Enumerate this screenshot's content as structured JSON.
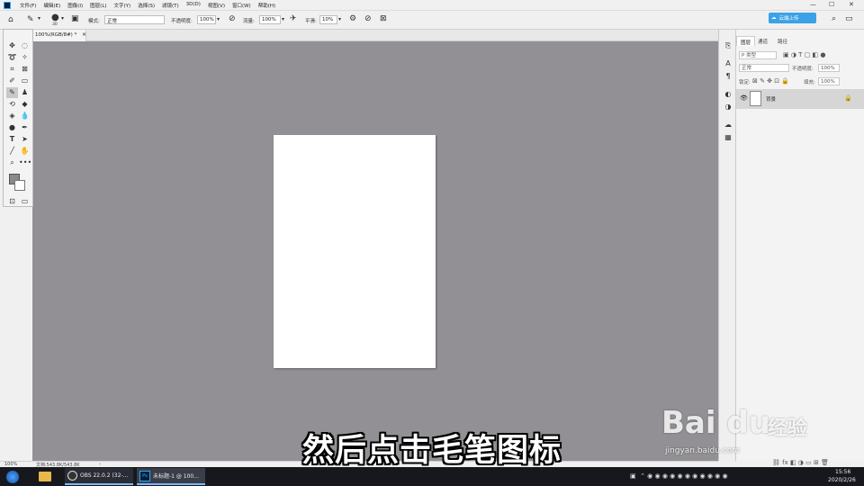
{
  "menubar": {
    "items": [
      "文件(F)",
      "编辑(E)",
      "图像(I)",
      "图层(L)",
      "文字(Y)",
      "选择(S)",
      "滤镜(T)",
      "3D(D)",
      "视图(V)",
      "窗口(W)",
      "帮助(H)"
    ],
    "minimize": "—",
    "maximize": "☐",
    "close": "✕"
  },
  "options": {
    "brush_size": "30",
    "mode_label": "模式:",
    "mode_value": "正常",
    "opacity_label": "不透明度:",
    "opacity_value": "100%",
    "flow_label": "流量:",
    "flow_value": "100%",
    "smoothing_label": "平滑:",
    "smoothing_value": "10%",
    "cloud_upload": "云端上传"
  },
  "document": {
    "tab_title": "100%(RGB/8#) *",
    "close_glyph": "✕"
  },
  "panel": {
    "tabs": [
      "图层",
      "通道",
      "路径"
    ],
    "kind_filter": "P 类型",
    "blend_mode": "正常",
    "opacity_label": "不透明度:",
    "opacity_value": "100%",
    "lock_label": "锁定:",
    "fill_label": "填充:",
    "fill_value": "100%",
    "layer_name": "背景"
  },
  "status": {
    "zoom": "100%",
    "doc_info": "文档:543.8K/543.8K",
    "arrow": "›"
  },
  "taskbar": {
    "obs_label": "OBS 22.0.2 (32-...",
    "ps_label": "未标题-1 @ 100...",
    "ps_badge": "Ps",
    "time": "15:56",
    "date": "2020/2/26"
  },
  "subtitle": "然后点击毛笔图标",
  "watermark": {
    "logo": "Bai du",
    "cn": "经验",
    "url": "jingyan.baidu.com"
  },
  "colors": {
    "canvas_bg": "#929095",
    "accent": "#3ba2e8",
    "ps_blue": "#31a8ff",
    "taskbar": "#16181e",
    "doc": "#ffffff"
  }
}
